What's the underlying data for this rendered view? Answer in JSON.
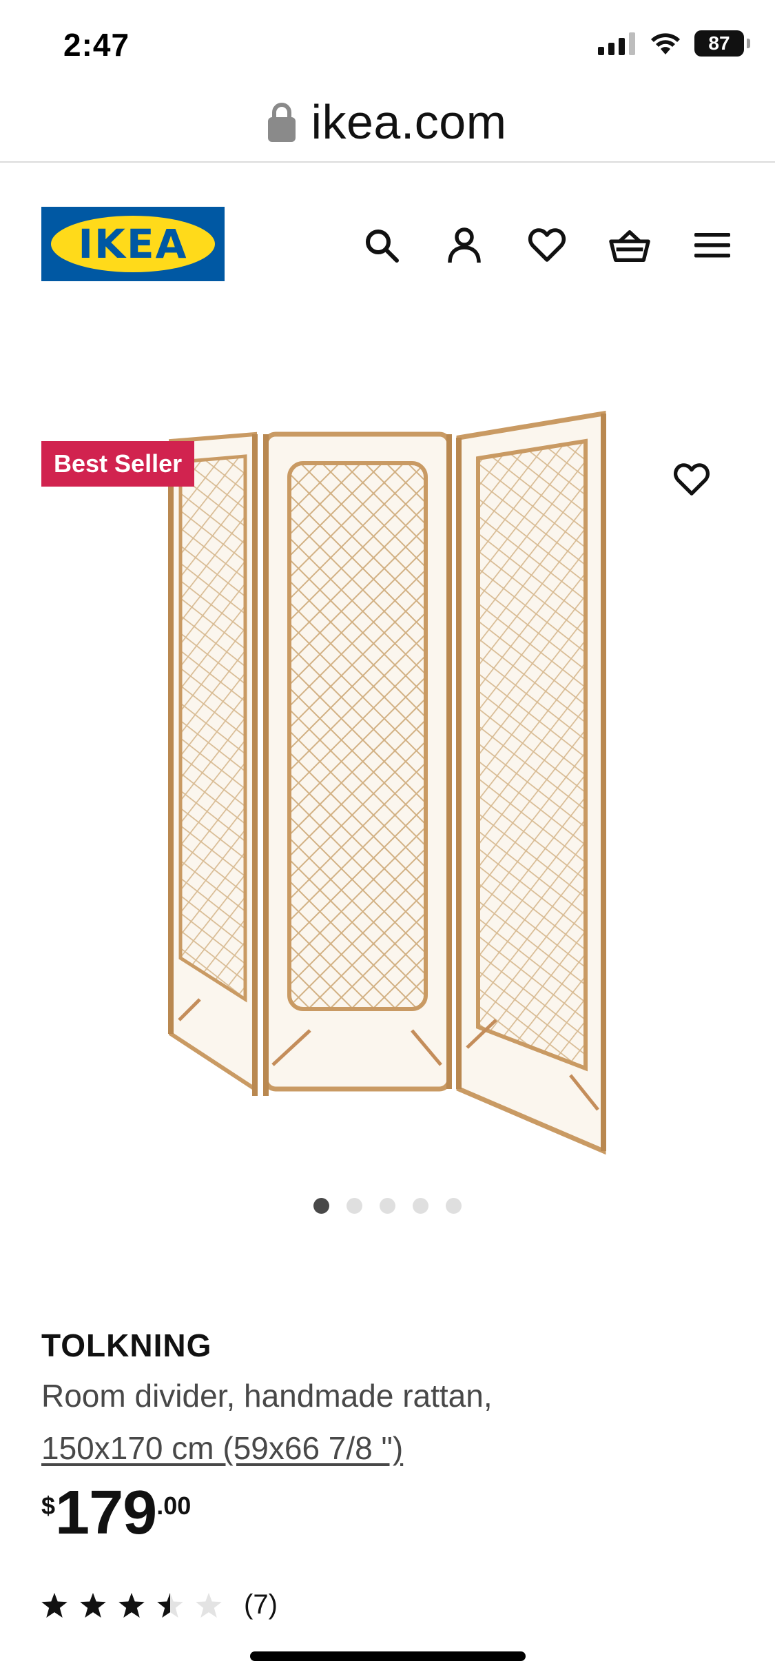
{
  "status_bar": {
    "time": "2:47",
    "battery": "87"
  },
  "browser": {
    "url": "ikea.com"
  },
  "header": {
    "logo_text": "IKEA",
    "icons": [
      "search-icon",
      "account-icon",
      "heart-icon",
      "basket-icon",
      "menu-icon"
    ]
  },
  "gallery": {
    "badge": "Best Seller",
    "slide_count": 5,
    "active_slide": 1
  },
  "product": {
    "name": "TOLKNING",
    "description": "Room divider, handmade rattan,",
    "size": "150x170 cm (59x66 7/8 \")",
    "price": {
      "currency": "$",
      "integer": "179",
      "decimal": ".00"
    },
    "rating": {
      "value": 3.5,
      "max": 5,
      "count": "(7)"
    }
  },
  "colors": {
    "ikea_blue": "#0058a3",
    "ikea_yellow": "#ffda1a",
    "badge": "#d1234f"
  }
}
